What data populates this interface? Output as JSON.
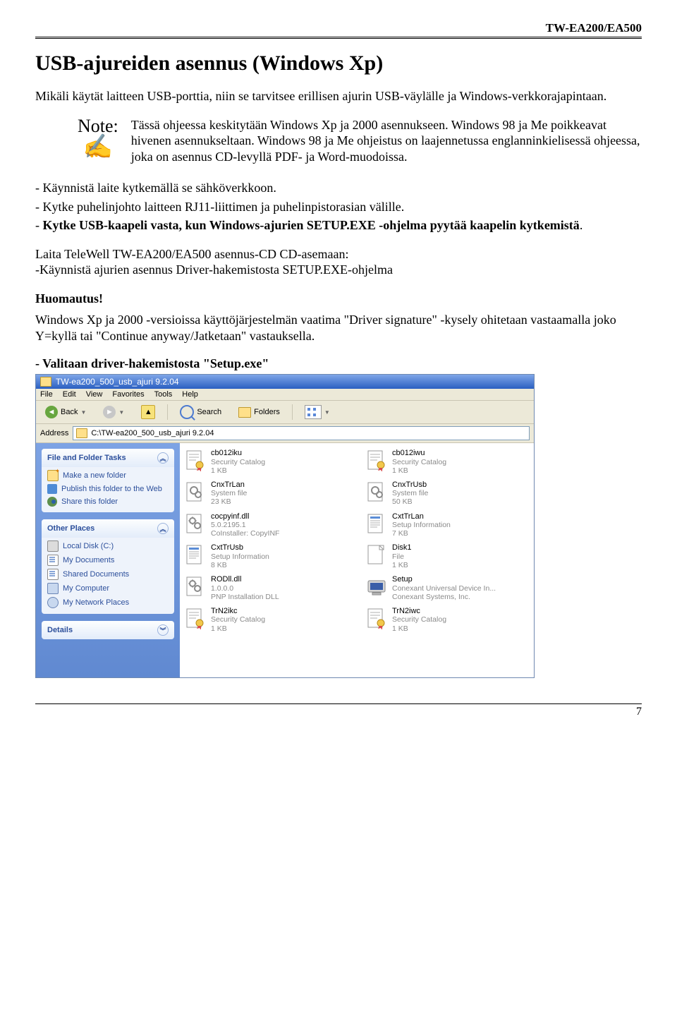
{
  "header": {
    "model": "TW-EA200/EA500"
  },
  "title": "USB-ajureiden asennus (Windows Xp)",
  "intro": "Mikäli käytät laitteen USB-porttia, niin se tarvitsee erillisen ajurin USB-väylälle ja Windows-verkkorajapintaan.",
  "note": {
    "label": "Note:",
    "hand": "✍",
    "text": "Tässä ohjeessa keskitytään Windows Xp ja 2000 asennukseen. Windows 98 ja Me poikkeavat hivenen asennukseltaan. Windows 98 ja Me ohjeistus on laajennetussa englanninkielisessä ohjeessa, joka on asennus CD-levyllä PDF- ja Word-muodoissa."
  },
  "steps": {
    "a": "- Käynnistä laite kytkemällä se sähköverkkoon.",
    "b": "- Kytke puhelinjohto laitteen RJ11-liittimen ja puhelinpistorasian välille.",
    "c_prefix": "- ",
    "c_bold": "Kytke USB-kaapeli vasta, kun Windows-ajurien SETUP.EXE -ohjelma pyytää kaapelin kytkemistä",
    "c_suffix": "."
  },
  "insertcd": "Laita TeleWell TW-EA200/EA500 asennus-CD CD-asemaan:\n-Käynnistä ajurien asennus Driver-hakemistosta SETUP.EXE-ohjelma",
  "huom_heading": "Huomautus!",
  "huom_text": "Windows Xp ja 2000 -versioissa käyttöjärjestelmän vaatima \"Driver signature\" -kysely ohitetaan vastaamalla joko Y=kyllä tai \"Continue anyway/Jatketaan\" vastauksella.",
  "select_setup": "- Valitaan driver-hakemistosta \"Setup.exe\"",
  "explorer": {
    "title": "TW-ea200_500_usb_ajuri 9.2.04",
    "menu": [
      "File",
      "Edit",
      "View",
      "Favorites",
      "Tools",
      "Help"
    ],
    "toolbar": {
      "back": "Back",
      "search": "Search",
      "folders": "Folders"
    },
    "address_label": "Address",
    "address_value": "C:\\TW-ea200_500_usb_ajuri 9.2.04",
    "side": {
      "tasks": {
        "title": "File and Folder Tasks",
        "items": [
          "Make a new folder",
          "Publish this folder to the Web",
          "Share this folder"
        ]
      },
      "places": {
        "title": "Other Places",
        "items": [
          "Local Disk (C:)",
          "My Documents",
          "Shared Documents",
          "My Computer",
          "My Network Places"
        ]
      },
      "details": {
        "title": "Details"
      }
    },
    "files": [
      {
        "name": "cb012iku",
        "sub1": "Security Catalog",
        "sub2": "1 KB",
        "kind": "cert"
      },
      {
        "name": "cb012iwu",
        "sub1": "Security Catalog",
        "sub2": "1 KB",
        "kind": "cert"
      },
      {
        "name": "CnxTrLan",
        "sub1": "System file",
        "sub2": "23 KB",
        "kind": "sys"
      },
      {
        "name": "CnxTrUsb",
        "sub1": "System file",
        "sub2": "50 KB",
        "kind": "sys"
      },
      {
        "name": "cocpyinf.dll",
        "sub1": "5.0.2195.1",
        "sub2": "CoInstaller: CopyINF",
        "kind": "dll"
      },
      {
        "name": "CxtTrLan",
        "sub1": "Setup Information",
        "sub2": "7 KB",
        "kind": "info"
      },
      {
        "name": "CxtTrUsb",
        "sub1": "Setup Information",
        "sub2": "8 KB",
        "kind": "info"
      },
      {
        "name": "Disk1",
        "sub1": "File",
        "sub2": "1 KB",
        "kind": "disk"
      },
      {
        "name": "RODll.dll",
        "sub1": "1.0.0.0",
        "sub2": "PNP Installation DLL",
        "kind": "dll"
      },
      {
        "name": "Setup",
        "sub1": "Conexant Universal Device In...",
        "sub2": "Conexant Systems, Inc.",
        "kind": "setup"
      },
      {
        "name": "TrN2ikc",
        "sub1": "Security Catalog",
        "sub2": "1 KB",
        "kind": "cert"
      },
      {
        "name": "TrN2iwc",
        "sub1": "Security Catalog",
        "sub2": "1 KB",
        "kind": "cert"
      }
    ]
  },
  "page_number": "7"
}
